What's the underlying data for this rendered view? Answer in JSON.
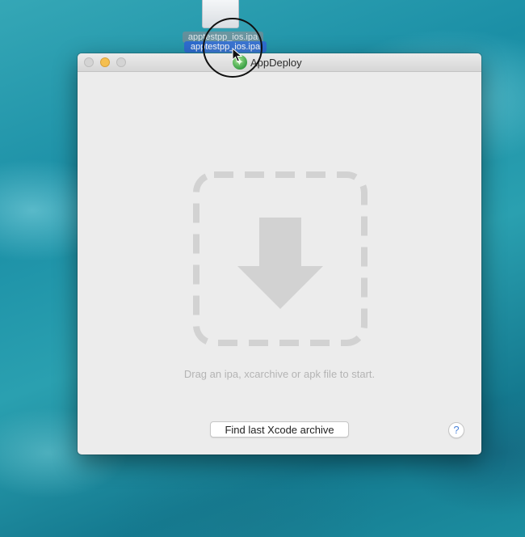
{
  "desktop": {
    "file_label": "apptestpp_ios.ipa",
    "drag_label": "apptestpp_ios.ipa"
  },
  "window": {
    "title": "AppDeploy",
    "app_icon": "appdeploy-icon",
    "drop_icon": "download-arrow-icon",
    "drop_hint": "Drag an ipa, xcarchive or apk file to start.",
    "find_button_label": "Find last Xcode archive",
    "help_label": "?"
  },
  "colors": {
    "background": "#ececec",
    "drop_zone": "#d2d2d2",
    "hint_text": "#b4b4b4",
    "drag_selection": "#2f6ed1",
    "minimize": "#f5bf4f",
    "help": "#4b83d8"
  }
}
